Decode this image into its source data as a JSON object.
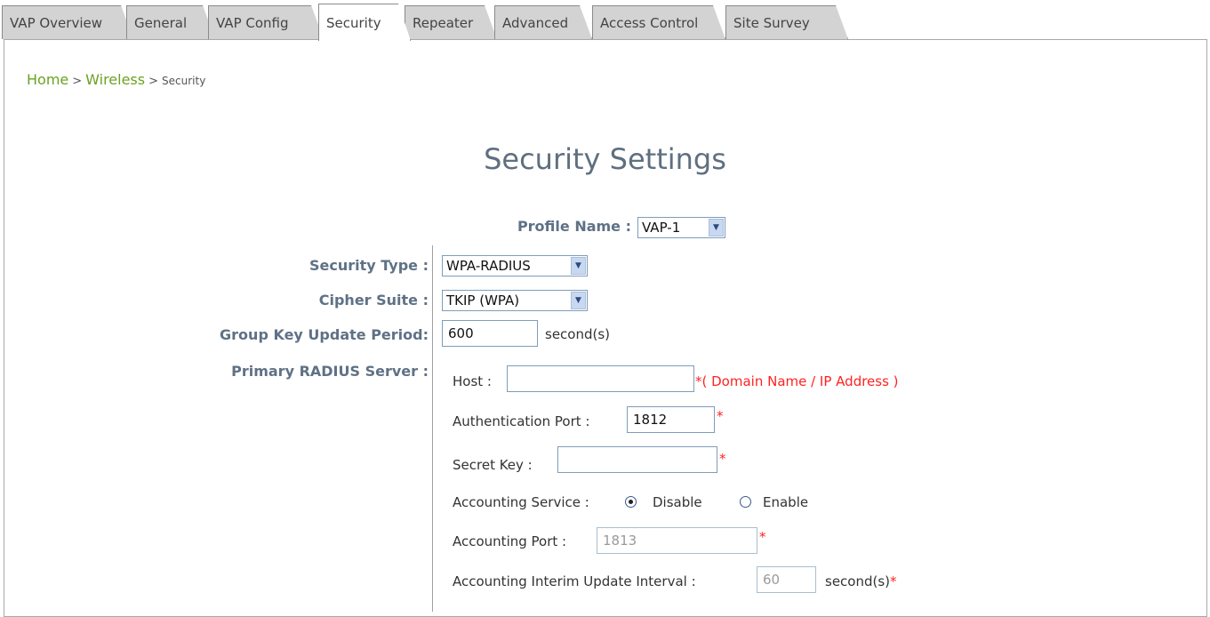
{
  "tabs": [
    {
      "label": "VAP Overview",
      "active": false
    },
    {
      "label": "General",
      "active": false
    },
    {
      "label": "VAP Config",
      "active": false
    },
    {
      "label": "Security",
      "active": true
    },
    {
      "label": "Repeater",
      "active": false
    },
    {
      "label": "Advanced",
      "active": false
    },
    {
      "label": "Access Control",
      "active": false
    },
    {
      "label": "Site Survey",
      "active": false
    }
  ],
  "breadcrumb": {
    "home": "Home",
    "sep1": ">",
    "wireless": "Wireless",
    "sep2": ">",
    "current": "Security"
  },
  "title": "Security Settings",
  "profile": {
    "label": "Profile Name :",
    "value": "VAP-1"
  },
  "security_type": {
    "label": "Security Type :",
    "value": "WPA-RADIUS"
  },
  "cipher_suite": {
    "label": "Cipher Suite :",
    "value": "TKIP (WPA)"
  },
  "group_key": {
    "label": "Group Key Update Period:",
    "value": "600",
    "unit": "second(s)"
  },
  "radius": {
    "label": "Primary RADIUS Server :",
    "host_label": "Host :",
    "host_value": "",
    "host_hint": "*( Domain Name / IP Address )",
    "auth_port_label": "Authentication Port :",
    "auth_port_value": "1812",
    "secret_label": "Secret Key :",
    "secret_value": "",
    "acct_service_label": "Accounting Service :",
    "acct_disable": "Disable",
    "acct_enable": "Enable",
    "acct_selected": "Disable",
    "acct_port_label": "Accounting Port :",
    "acct_port_value": "1813",
    "interim_label": "Accounting Interim Update Interval :",
    "interim_value": "60",
    "interim_unit": "second(s)",
    "required_mark": "*"
  },
  "colors": {
    "link": "#6aa321",
    "label": "#5f7185",
    "required": "#ff2222"
  }
}
